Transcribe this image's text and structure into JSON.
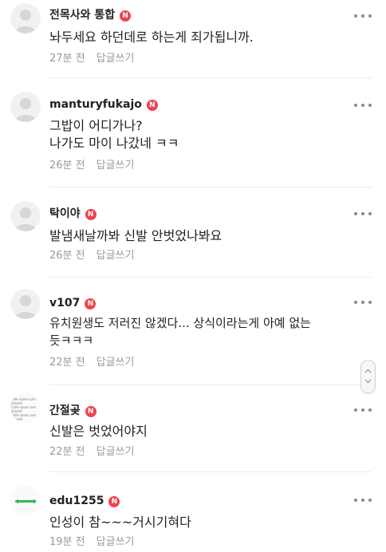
{
  "comments": [
    {
      "author": "전목사와 통합",
      "badge": "N",
      "text": "놔두세요 하던데로 하는게 죄가됩니까.",
      "time": "27분 전",
      "reply_label": "답글쓰기",
      "avatar": "default-avatar-icon"
    },
    {
      "author": "manturyfukajo",
      "badge": "N",
      "text_lines": [
        "그밥이 어디가나?",
        "나가도 마이 나갔네 ㅋㅋ"
      ],
      "time": "26분 전",
      "reply_label": "답글쓰기",
      "avatar": "default-avatar-icon"
    },
    {
      "author": "탁이야",
      "badge": "N",
      "text": "발냄새날까봐 신발 안벗었나봐요",
      "time": "26분 전",
      "reply_label": "답글쓰기",
      "avatar": "default-avatar-icon"
    },
    {
      "author": "v107",
      "badge": "N",
      "text_lines": [
        "유치원생도 저러진 않겠다... 상식이라는게 아예 없는",
        "듯ㅋㅋㅋ"
      ],
      "time": "22분 전",
      "reply_label": "답글쓰기",
      "avatar": "default-avatar-icon"
    },
    {
      "author": "간절곶",
      "badge": "N",
      "text": "신발은 벗었어야지",
      "time": "22분 전",
      "reply_label": "답글쓰기",
      "avatar": "cafe-logo-avatar",
      "avatar_text": [
        "cafe.naver.com",
        "/lsesall",
        "Cafe.naver.com",
        "/lsesall",
        "Cafe.naver.com",
        "/lsesall"
      ]
    },
    {
      "author": "edu1255",
      "badge": "N",
      "text": "인성이 참~~~거시기혀다",
      "time": "19분 전",
      "reply_label": "답글쓰기",
      "avatar": "green-link-avatar"
    }
  ],
  "colors": {
    "badge": "#f0434f",
    "meta_text": "#9a9a9a",
    "body_text": "#222222",
    "divider": "#ececec"
  }
}
